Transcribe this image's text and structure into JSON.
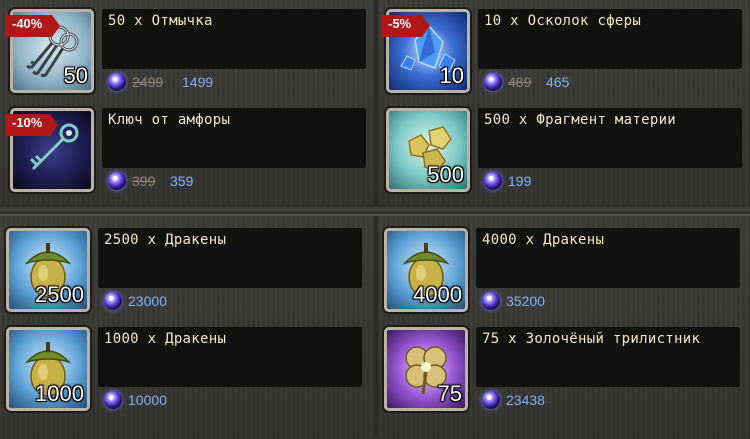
{
  "items": [
    {
      "name": "50 х Отмычка",
      "qty": "50",
      "discount": "-40%",
      "old_price": "2499",
      "price": "1499",
      "icon": "lockpick-keys-icon"
    },
    {
      "name": "10 х Осколок сферы",
      "qty": "10",
      "discount": "-5%",
      "old_price": "489",
      "price": "465",
      "icon": "sphere-shard-icon"
    },
    {
      "name": "Ключ от амфоры",
      "qty": "",
      "discount": "-10%",
      "old_price": "399",
      "price": "359",
      "icon": "amphora-key-icon"
    },
    {
      "name": "500 х Фрагмент материи",
      "qty": "500",
      "discount": "",
      "old_price": "",
      "price": "199",
      "icon": "matter-fragment-icon"
    },
    {
      "name": "2500 х Дракены",
      "qty": "2500",
      "discount": "",
      "old_price": "",
      "price": "23000",
      "icon": "acorn-draken-icon"
    },
    {
      "name": "4000 х Дракены",
      "qty": "4000",
      "discount": "",
      "old_price": "",
      "price": "35200",
      "icon": "acorn-draken-icon"
    },
    {
      "name": "1000 х Дракены",
      "qty": "1000",
      "discount": "",
      "old_price": "",
      "price": "10000",
      "icon": "acorn-draken-icon"
    },
    {
      "name": "75 х Золочёный трилистник",
      "qty": "75",
      "discount": "",
      "old_price": "",
      "price": "23438",
      "icon": "golden-trefoil-icon"
    }
  ],
  "colors": {
    "price": "#7fb2ff",
    "old_price": "#8e8778",
    "name": "#f1e9c2",
    "discount_tag": "#b01818"
  },
  "currency_icon": "crystal-gem-icon"
}
